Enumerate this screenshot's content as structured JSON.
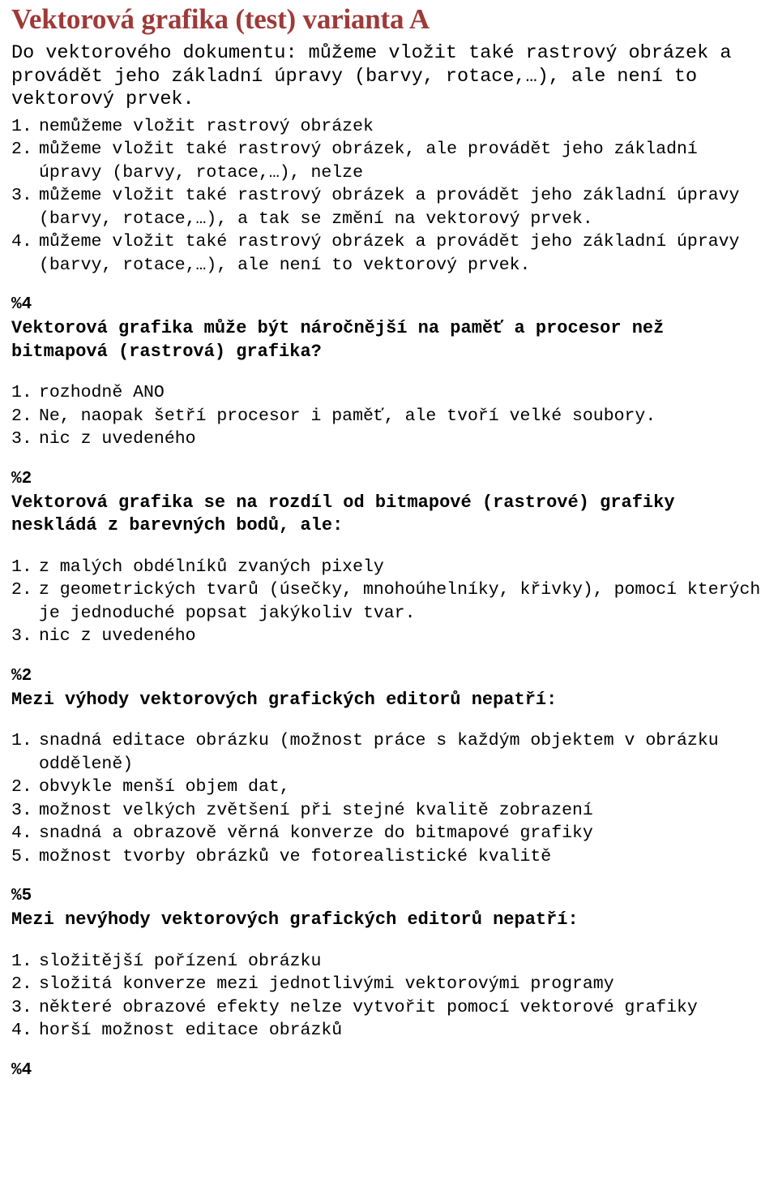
{
  "document": {
    "title": "Vektorová grafika (test) varianta A",
    "title_color": "#9e3a38",
    "intro": "Do vektorového dokumentu: můžeme vložit také rastrový obrázek a provádět jeho základní úpravy (barvy, rotace,…), ale není to vektorový prvek.",
    "trailing_marker": "%4"
  },
  "blocks": [
    {
      "marker": "",
      "question": "",
      "answers": [
        {
          "num": "1.",
          "text": "nemůžeme vložit rastrový obrázek"
        },
        {
          "num": "2.",
          "text": "můžeme vložit také rastrový obrázek, ale provádět jeho základní úpravy (barvy, rotace,…), nelze"
        },
        {
          "num": "3.",
          "text": "můžeme vložit také rastrový obrázek a provádět jeho základní úpravy (barvy, rotace,…), a tak se změní na vektorový prvek."
        },
        {
          "num": "4.",
          "text": "můžeme vložit také rastrový obrázek a provádět jeho základní úpravy (barvy, rotace,…), ale není to vektorový prvek."
        }
      ]
    },
    {
      "marker": "%4",
      "question": "Vektorová grafika může být náročnější na paměť a procesor než bitmapová (rastrová) grafika?",
      "answers": [
        {
          "num": "1.",
          "text": "rozhodně ANO"
        },
        {
          "num": "2.",
          "text": "Ne, naopak šetří procesor i paměť, ale tvoří velké soubory."
        },
        {
          "num": "3.",
          "text": "nic z uvedeného"
        }
      ]
    },
    {
      "marker": "%2",
      "question": "Vektorová grafika se na rozdíl od bitmapové (rastrové) grafiky neskládá z barevných bodů, ale:",
      "answers": [
        {
          "num": "1.",
          "text": "z malých obdélníků zvaných pixely"
        },
        {
          "num": "2.",
          "text": "z geometrických tvarů (úsečky, mnohoúhelníky, křivky), pomocí kterých je jednoduché popsat jakýkoliv tvar."
        },
        {
          "num": "3.",
          "text": "nic z uvedeného"
        }
      ]
    },
    {
      "marker": "%2",
      "question": "Mezi výhody vektorových grafických editorů nepatří:",
      "answers": [
        {
          "num": "1.",
          "text": "snadná editace obrázku (možnost práce s každým objektem v obrázku odděleně)"
        },
        {
          "num": "2.",
          "text": "obvykle menší objem dat,"
        },
        {
          "num": "3.",
          "text": "možnost velkých zvětšení při stejné kvalitě zobrazení"
        },
        {
          "num": "4.",
          "text": "snadná a obrazově věrná konverze do bitmapové grafiky"
        },
        {
          "num": "5.",
          "text": "možnost tvorby obrázků ve fotorealistické kvalitě"
        }
      ]
    },
    {
      "marker": "%5",
      "question": "Mezi nevýhody vektorových grafických editorů nepatří:",
      "answers": [
        {
          "num": "1.",
          "text": "složitější pořízení obrázku"
        },
        {
          "num": "2.",
          "text": "složitá konverze mezi jednotlivými vektorovými programy"
        },
        {
          "num": "3.",
          "text": "některé obrazové efekty nelze vytvořit pomocí vektorové grafiky"
        },
        {
          "num": "4.",
          "text": "horší možnost editace obrázků"
        }
      ]
    }
  ]
}
